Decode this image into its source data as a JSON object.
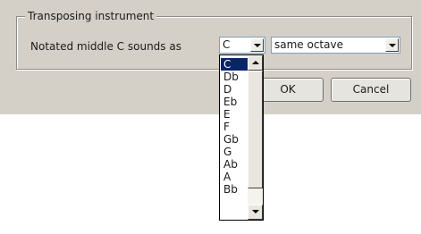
{
  "dialog": {
    "group_title": "Transposing instrument",
    "row_label": "Notated middle C sounds as",
    "note_select": {
      "value": "C"
    },
    "octave_select": {
      "value": "same octave"
    },
    "ok_label": "OK",
    "cancel_label": "Cancel"
  },
  "note_dropdown": {
    "selected_index": 0,
    "options": [
      "C",
      "Db",
      "D",
      "Eb",
      "E",
      "F",
      "Gb",
      "G",
      "Ab",
      "A",
      "Bb"
    ]
  },
  "colors": {
    "dialog_bg": "#d4d0c8",
    "selection": "#0a246a"
  }
}
